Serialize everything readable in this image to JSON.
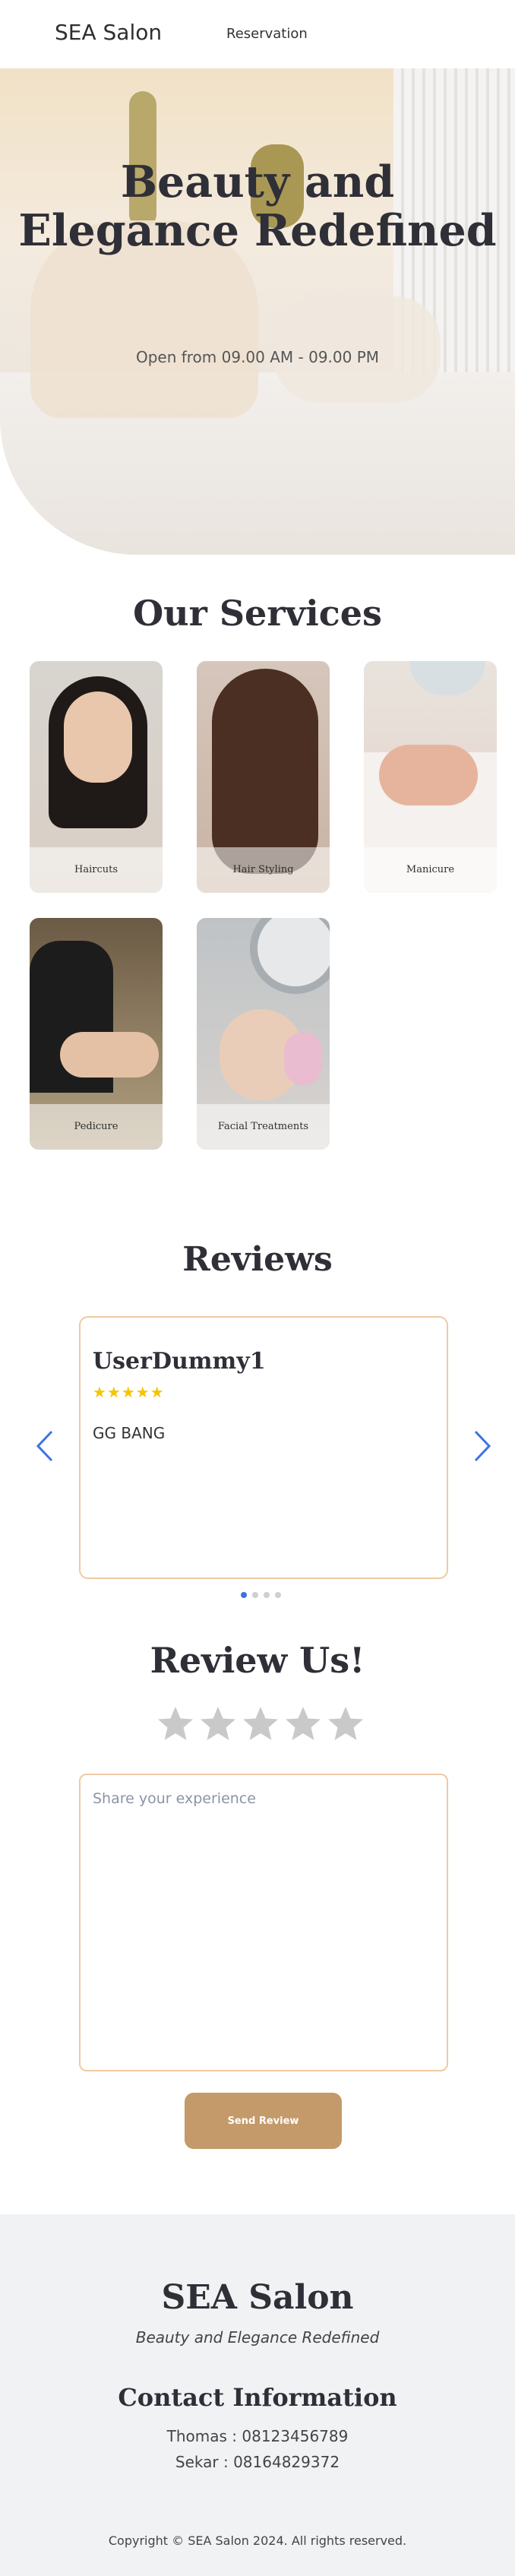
{
  "navbar": {
    "brand": "SEA Salon",
    "reservation": "Reservation"
  },
  "hero": {
    "title_line1": "Beauty and",
    "title_line2": "Elegance Redefined",
    "hours": "Open from 09.00 AM - 09.00 PM"
  },
  "services": {
    "title": "Our Services",
    "items": [
      {
        "label": "Haircuts"
      },
      {
        "label": "Hair Styling"
      },
      {
        "label": "Manicure"
      },
      {
        "label": "Pedicure"
      },
      {
        "label": "Facial Treatments"
      }
    ]
  },
  "reviews": {
    "title": "Reviews",
    "current": {
      "user": "UserDummy1",
      "stars": "★★★★★",
      "rating": 5,
      "text": "GG BANG"
    },
    "pagination": {
      "total": 4,
      "active": 1
    }
  },
  "review_form": {
    "title": "Review Us!",
    "rating": 0,
    "placeholder": "Share your experience",
    "submit_label": "Send Review"
  },
  "footer": {
    "brand": "SEA Salon",
    "tagline": "Beauty and Elegance Redefined",
    "contact_title": "Contact Information",
    "contacts": [
      "Thomas : 08123456789",
      "Sekar : 08164829372"
    ],
    "copyright": "Copyright © SEA Salon 2024. All rights reserved."
  },
  "colors": {
    "accent": "#c49a6a",
    "border": "#efc9a3",
    "star_filled": "#f5c400",
    "star_empty": "#c9c9c9",
    "carousel_arrow": "#3b73e6",
    "footer_bg": "#f1f2f4"
  }
}
